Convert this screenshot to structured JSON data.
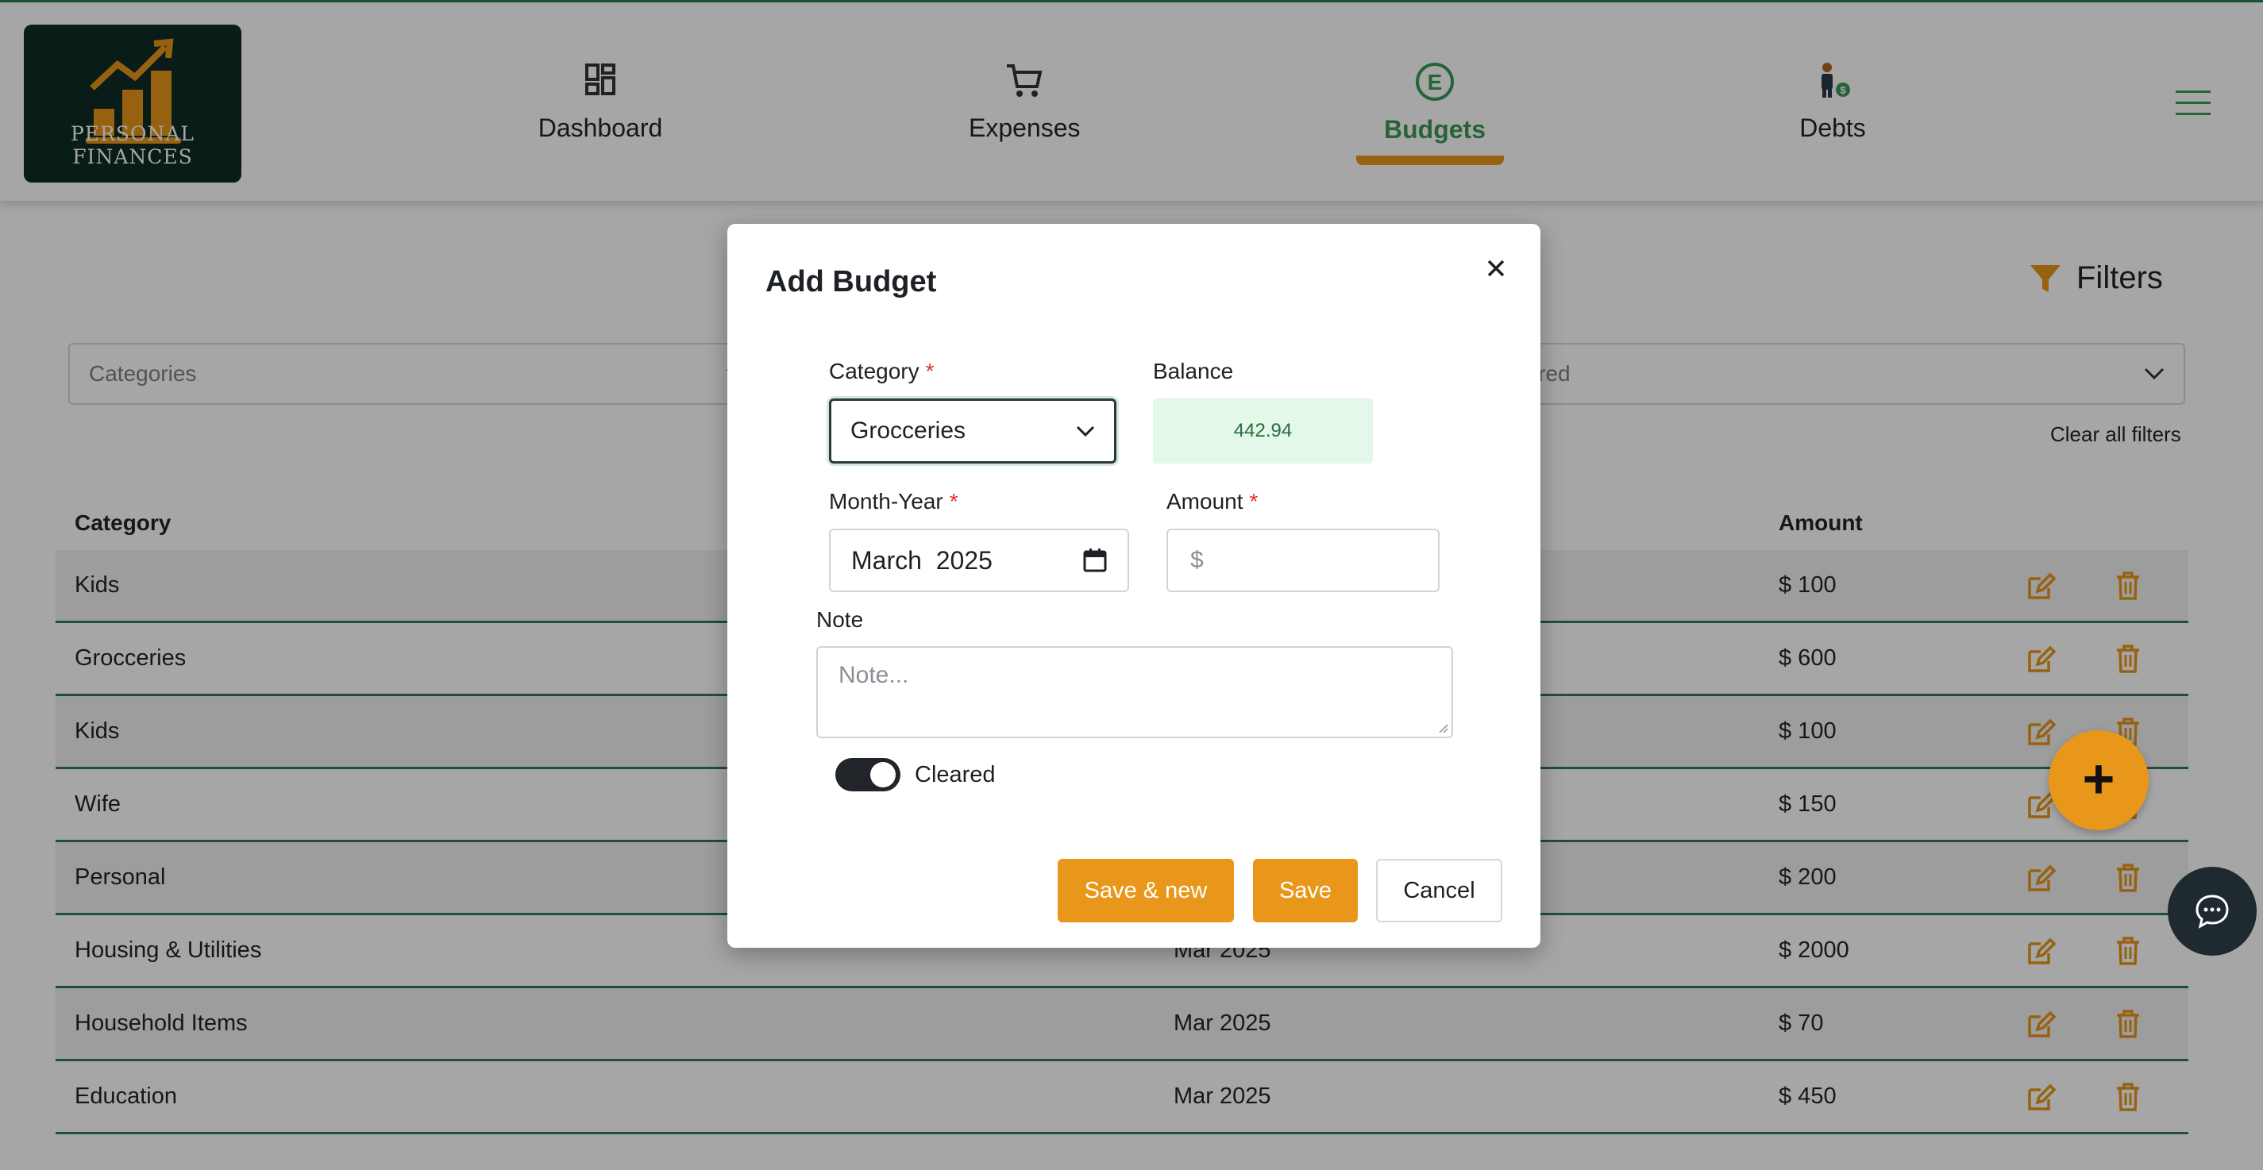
{
  "brand": {
    "logo_text": "PERSONAL FINANCES",
    "colors": {
      "primary": "#e8971a",
      "accent_green": "#3b9a57",
      "logo_bg": "#0f2c26"
    }
  },
  "nav": {
    "items": [
      {
        "label": "Dashboard",
        "icon": "dashboard-icon"
      },
      {
        "label": "Expenses",
        "icon": "cart-icon"
      },
      {
        "label": "Budgets",
        "icon": "budget-icon",
        "active": true
      },
      {
        "label": "Debts",
        "icon": "debts-icon"
      }
    ],
    "menu_icon": "hamburger-icon"
  },
  "filters": {
    "label": "Filters",
    "categories_placeholder": "Categories",
    "cleared_placeholder": "eared",
    "clear_all": "Clear all filters"
  },
  "table": {
    "headers": {
      "category": "Category",
      "amount": "Amount"
    },
    "rows": [
      {
        "category": "Kids",
        "month": "",
        "amount": "$ 100"
      },
      {
        "category": "Grocceries",
        "month": "",
        "amount": "$ 600"
      },
      {
        "category": "Kids",
        "month": "",
        "amount": "$ 100"
      },
      {
        "category": "Wife",
        "month": "",
        "amount": "$ 150"
      },
      {
        "category": "Personal",
        "month": "",
        "amount": "$ 200"
      },
      {
        "category": "Housing & Utilities",
        "month": "Mar 2025",
        "amount": "$ 2000"
      },
      {
        "category": "Household Items",
        "month": "Mar 2025",
        "amount": "$ 70"
      },
      {
        "category": "Education",
        "month": "Mar 2025",
        "amount": "$ 450"
      }
    ]
  },
  "fab_label": "+",
  "modal": {
    "title": "Add Budget",
    "category": {
      "label": "Category",
      "required_mark": "*",
      "value": "Grocceries"
    },
    "balance": {
      "label": "Balance",
      "value": "442.94"
    },
    "month_year": {
      "label": "Month-Year",
      "required_mark": "*",
      "value": "March  2025"
    },
    "amount": {
      "label": "Amount",
      "required_mark": "*",
      "prefix": "$",
      "value": ""
    },
    "note": {
      "label": "Note",
      "placeholder": "Note..."
    },
    "cleared": {
      "label": "Cleared",
      "checked": true
    },
    "buttons": {
      "save_new": "Save & new",
      "save": "Save",
      "cancel": "Cancel"
    }
  }
}
